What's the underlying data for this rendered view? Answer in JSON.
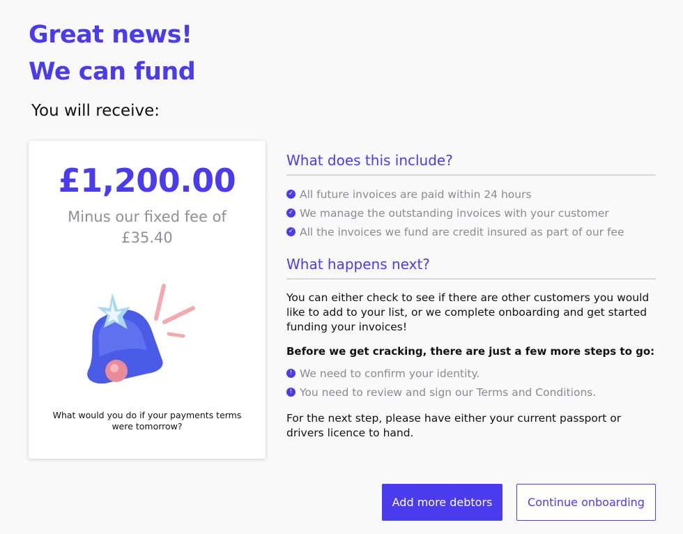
{
  "headline": {
    "line1": "Great news!",
    "line2": "We can fund"
  },
  "receive_label": "You will receive:",
  "card": {
    "amount": "£1,200.00",
    "fee_text": "Minus our fixed fee of £35.40",
    "illustration_icon": "bell-icon",
    "caption": "What would you do if your payments terms were tomorrow?"
  },
  "includes": {
    "title": "What does this include?",
    "items": [
      "All future invoices are paid within 24 hours",
      "We manage the outstanding invoices with your customer",
      "All the invoices we fund are credit insured as part of our fee"
    ]
  },
  "next": {
    "title": "What happens next?",
    "paragraph": "You can either check to see if there are other customers you would like to add to your list, or we complete onboarding and get started funding your invoices!",
    "steps_heading": "Before we get cracking, there are just a few more steps to go:",
    "steps": [
      "We need to confirm your identity.",
      "You need to review and sign our Terms and Conditions."
    ],
    "footer": "For the next step, please have either your current passport or drivers licence to hand."
  },
  "buttons": {
    "add_debtors": "Add more debtors",
    "continue": "Continue onboarding"
  },
  "colors": {
    "accent": "#4a3bef",
    "muted_text": "#8a8a92"
  }
}
